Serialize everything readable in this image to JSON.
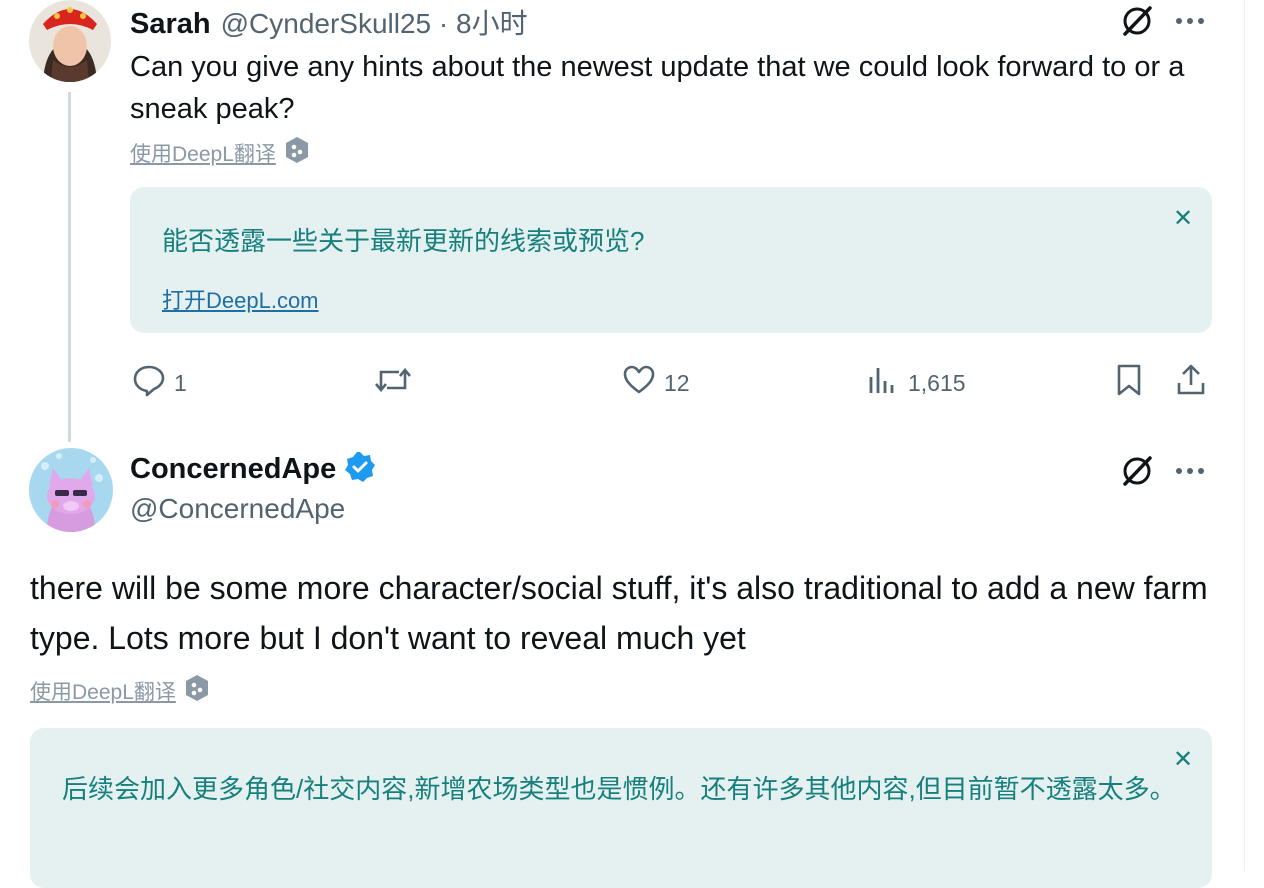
{
  "reply_tweet": {
    "author_name": "Sarah",
    "handle_time": "@CynderSkull25 · 8小时",
    "text": "Can you give any hints about the newest update that we could look forward to or a sneak peak?",
    "translate_label": "使用DeepL翻译",
    "translation": {
      "text": "能否透露一些关于最新更新的线索或预览?",
      "open_link": "打开DeepL.com",
      "close_icon": "close-icon"
    },
    "actions": {
      "replies": "1",
      "retweets": "",
      "likes": "12",
      "views": "1,615"
    },
    "icons": [
      "grok-icon",
      "more-icon",
      "reply-icon",
      "retweet-icon",
      "like-icon",
      "views-icon",
      "bookmark-icon",
      "share-icon"
    ]
  },
  "main_tweet": {
    "author_name": "ConcernedApe",
    "handle": "@ConcernedApe",
    "verified": true,
    "text": "there will be some more character/social stuff, it's also traditional to add a new farm type. Lots more but I don't want to reveal much yet",
    "translate_label": "使用DeepL翻译",
    "translation": {
      "text": "后续会加入更多角色/社交内容,新增农场类型也是惯例。还有许多其他内容,但目前暂不透露太多。",
      "close_icon": "close-icon"
    },
    "icons": [
      "grok-icon",
      "more-icon",
      "verified-badge-icon"
    ]
  },
  "colors": {
    "accent_blue": "#1d9bf0",
    "translation_bg": "#e5f0f1",
    "translation_text": "#17807d",
    "secondary_text": "#536471"
  }
}
